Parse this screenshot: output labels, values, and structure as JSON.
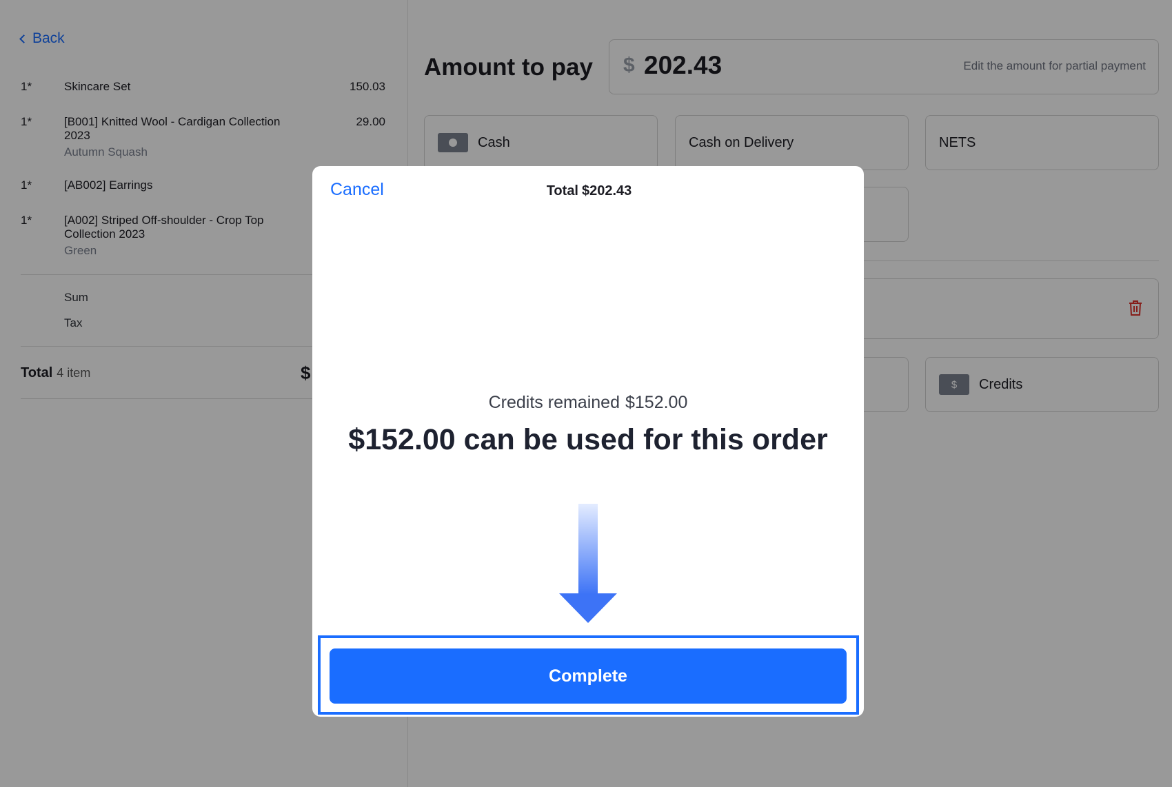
{
  "back_label": "Back",
  "order": {
    "items": [
      {
        "qty": "1*",
        "name": "Skincare Set",
        "variant": "",
        "price": "150.03"
      },
      {
        "qty": "1*",
        "name": "[B001] Knitted Wool - Cardigan Collection 2023",
        "variant": "Autumn Squash",
        "price": "29.00"
      },
      {
        "qty": "1*",
        "name": "[AB002] Earrings",
        "variant": "",
        "price": ""
      },
      {
        "qty": "1*",
        "name": "[A002] Striped Off-shoulder - Crop Top Collection 2023",
        "variant": "Green",
        "price": ""
      }
    ],
    "sum_label": "Sum",
    "tax_label": "Tax",
    "total_label": "Total",
    "total_count": "4 item",
    "total_amount_partial": "$"
  },
  "payment": {
    "title": "Amount to pay",
    "currency_symbol": "$",
    "amount": "202.43",
    "hint": "Edit the amount for partial payment",
    "methods": {
      "cash": "Cash",
      "cod": "Cash on Delivery",
      "nets": "NETS",
      "credits": "Credits"
    }
  },
  "modal": {
    "cancel_label": "Cancel",
    "title": "Total",
    "title_amount": "$202.43",
    "remained_label": "Credits remained",
    "remained_amount": "$152.00",
    "usable_text": "$152.00 can be used for this order",
    "complete_label": "Complete"
  },
  "colors": {
    "accent": "#1a6dff",
    "overlay": "rgba(0,0,0,0.4)",
    "danger": "#e0322c"
  },
  "icons": {
    "back": "chevron-left-icon",
    "cash": "cash-icon",
    "credits": "credits-icon",
    "trash": "trash-icon",
    "arrow": "arrow-down-icon"
  }
}
